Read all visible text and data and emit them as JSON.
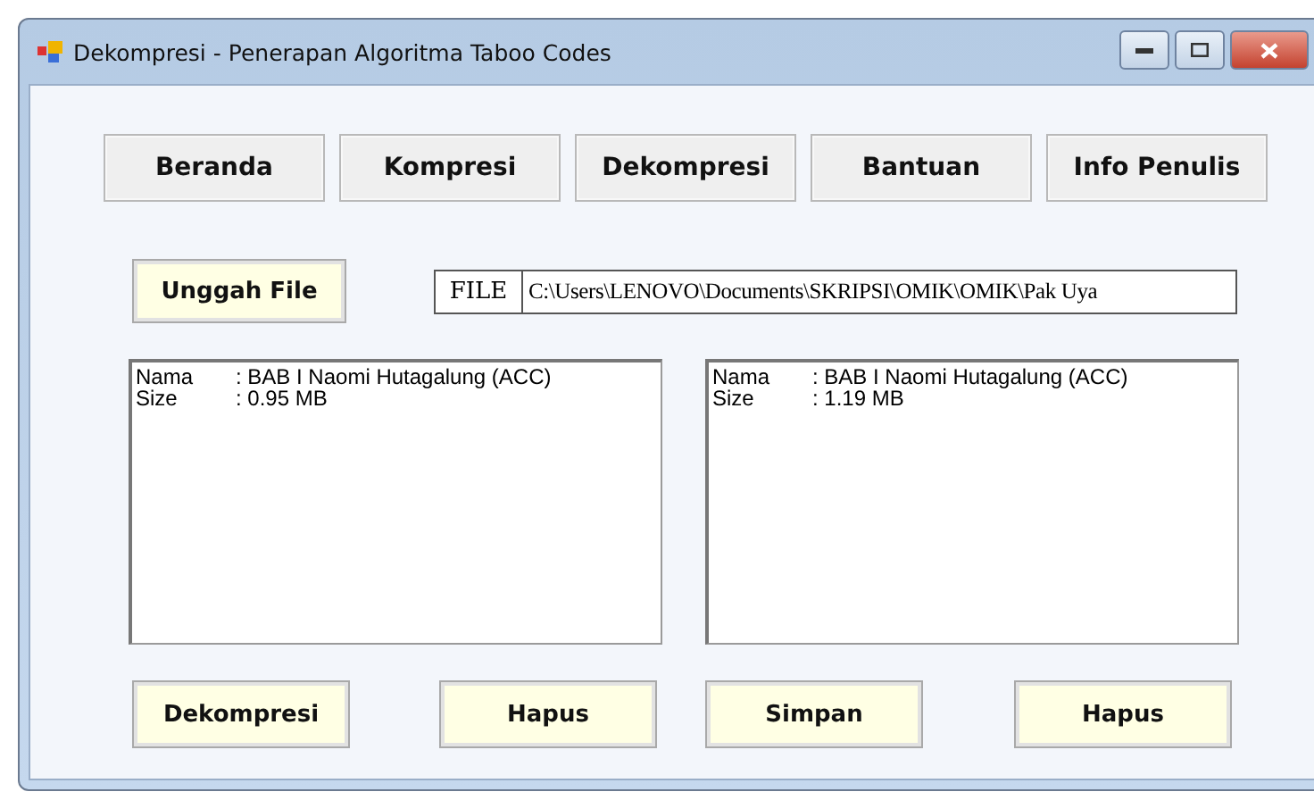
{
  "window": {
    "title": "Dekompresi - Penerapan Algoritma Taboo Codes"
  },
  "nav_buttons": [
    "Beranda",
    "Kompresi",
    "Dekompresi",
    "Bantuan",
    "Info Penulis"
  ],
  "upload_button": "Unggah File",
  "file_field": {
    "label": "FILE",
    "value": "C:\\Users\\LENOVO\\Documents\\SKRIPSI\\OMIK\\OMIK\\Pak Uya"
  },
  "panels": [
    {
      "lines": [
        {
          "key": "Nama",
          "value": ": BAB I Naomi Hutagalung (ACC)"
        },
        {
          "key": "Size",
          "value": ": 0.95 MB"
        }
      ]
    },
    {
      "lines": [
        {
          "key": "Nama",
          "value": ": BAB I Naomi Hutagalung (ACC)"
        },
        {
          "key": "Size",
          "value": ": 1.19 MB"
        }
      ]
    }
  ],
  "action_buttons": [
    "Dekompresi",
    "Hapus",
    "Simpan",
    "Hapus"
  ]
}
